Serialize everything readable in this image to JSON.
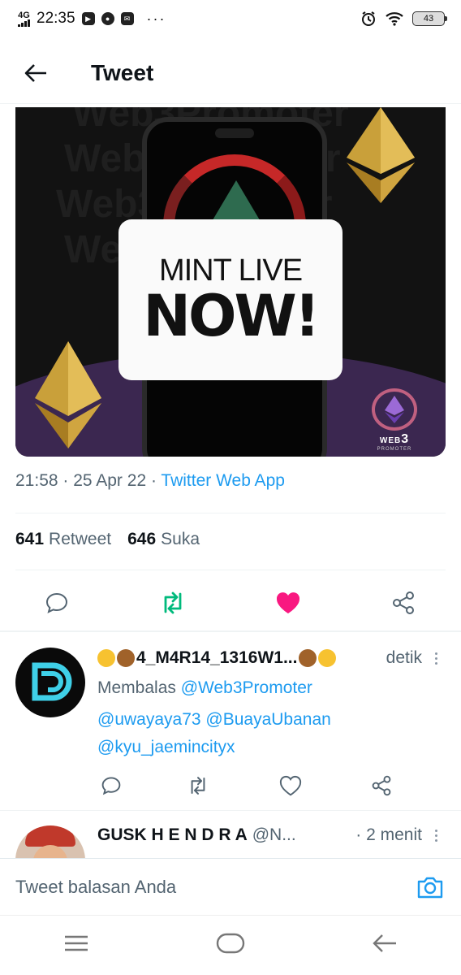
{
  "status_bar": {
    "network": "4G",
    "time": "22:35",
    "battery": "43",
    "overflow": "···"
  },
  "header": {
    "title": "Tweet"
  },
  "media": {
    "line1": "MINT LIVE",
    "line2": "NOW!",
    "watermark": "Web3Promoter",
    "badge_top": "WEB",
    "badge_num": "3",
    "badge_bottom": "PROMOTER"
  },
  "tweet": {
    "time_date": "21:58 · 25 Apr 22 · ",
    "source": "Twitter Web App",
    "retweet_count": "641",
    "retweet_label": "Retweet",
    "like_count": "646",
    "like_label": "Suka",
    "liked": true,
    "retweeted": true,
    "colors": {
      "retweet": "#00ba7c",
      "like": "#f91880",
      "link": "#1d9bf0"
    }
  },
  "replies": [
    {
      "name": "4_M4R14_1316W1...",
      "time": "detik",
      "replying_label": "Membalas",
      "mentions_line1": "@Web3Promoter",
      "mentions_line2a": "@uwayaya73",
      "mentions_line2b": "@BuayaUbanan",
      "mentions_line3": "@kyu_jaemincityx"
    },
    {
      "name": "GUSK H E N D R A",
      "handle": "@N...",
      "time": "· 2 menit"
    }
  ],
  "compose": {
    "placeholder": "Tweet balasan Anda"
  },
  "icons": [
    "back-arrow-icon",
    "reply-icon",
    "retweet-icon",
    "heart-icon",
    "share-icon",
    "camera-icon",
    "menu-icon",
    "home-icon",
    "back-nav-icon"
  ]
}
